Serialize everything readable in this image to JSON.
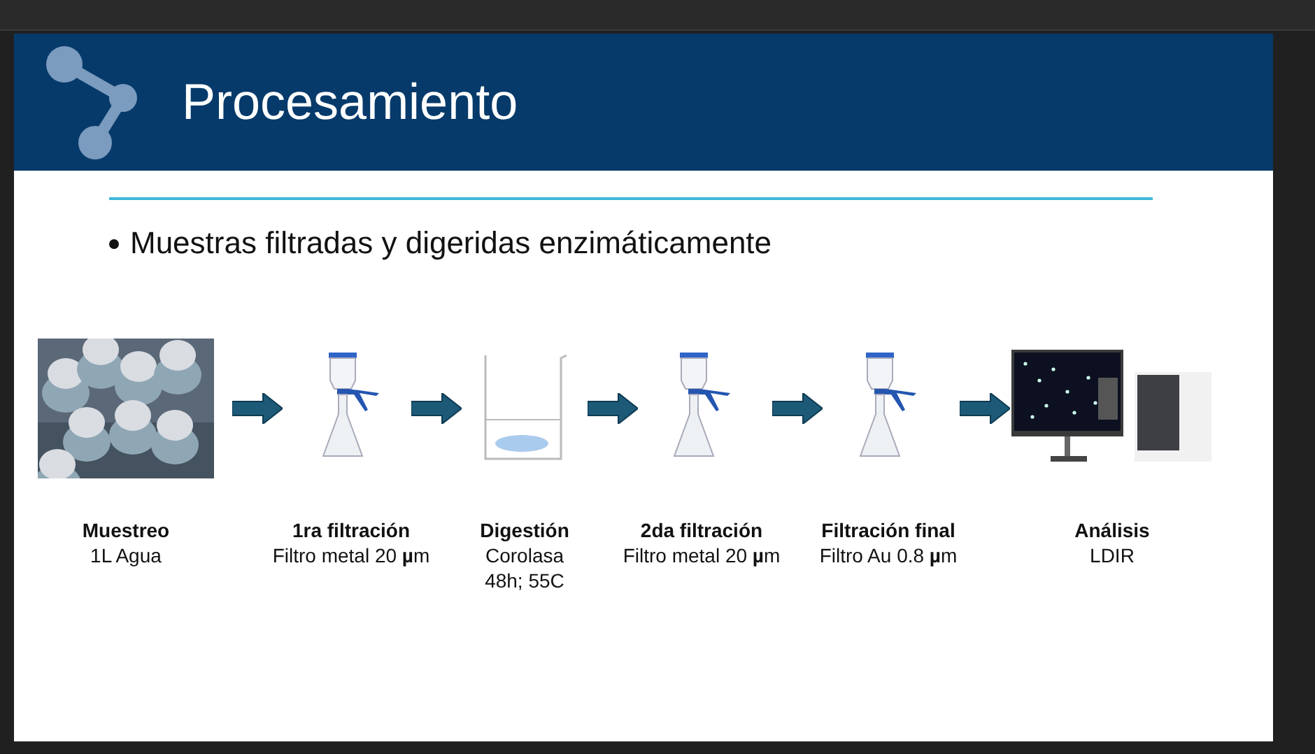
{
  "slide": {
    "title": "Procesamiento",
    "bullet": "Muestras filtradas y digeridas enzimáticamente",
    "steps": [
      {
        "title": "Muestreo",
        "lines": [
          "1L Agua"
        ]
      },
      {
        "kind": "filter",
        "title": "1ra filtración",
        "lines": [
          "Filtro metal 20 **µ**m"
        ]
      },
      {
        "kind": "beaker",
        "title": "Digestión",
        "lines": [
          "Corolasa",
          "48h; 55C"
        ]
      },
      {
        "kind": "filter",
        "title": "2da filtración",
        "lines": [
          "Filtro metal 20 **µ**m"
        ]
      },
      {
        "kind": "filter",
        "title": "Filtración final",
        "lines": [
          "Filtro Au 0.8 **µ**m"
        ]
      },
      {
        "kind": "analyzer",
        "title": "Análisis",
        "lines": [
          "LDIR"
        ]
      }
    ]
  }
}
